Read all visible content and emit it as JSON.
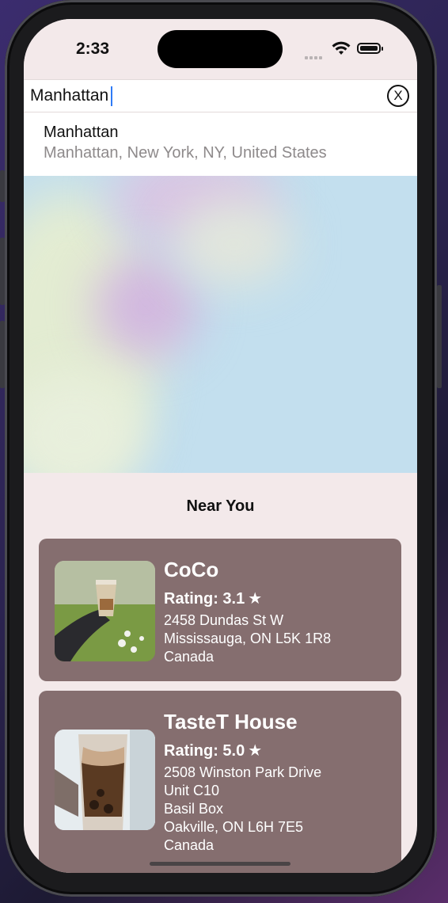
{
  "status_bar": {
    "time": "2:33"
  },
  "search": {
    "value": "Manhattan",
    "clear_label": "X"
  },
  "suggestion": {
    "title": "Manhattan",
    "subtitle": "Manhattan, New York, NY, United States"
  },
  "section_title": "Near You",
  "shops": [
    {
      "name": "CoCo",
      "rating_label": "Rating: 3.1",
      "address_lines": [
        "2458 Dundas St W",
        "Mississauga, ON L5K 1R8",
        "Canada"
      ]
    },
    {
      "name": "TasteT House",
      "rating_label": "Rating: 5.0",
      "address_lines": [
        "2508 Winston Park Drive",
        "Unit C10",
        "Basil Box",
        "Oakville, ON L6H 7E5",
        "Canada"
      ]
    }
  ],
  "icons": {
    "star": "star-icon",
    "wifi": "wifi-icon",
    "battery": "battery-icon",
    "clear": "clear-icon"
  },
  "colors": {
    "background": "#f3e9ea",
    "card": "#856e6f",
    "map_water": "#c3dfee",
    "caret": "#2f7bf6"
  }
}
